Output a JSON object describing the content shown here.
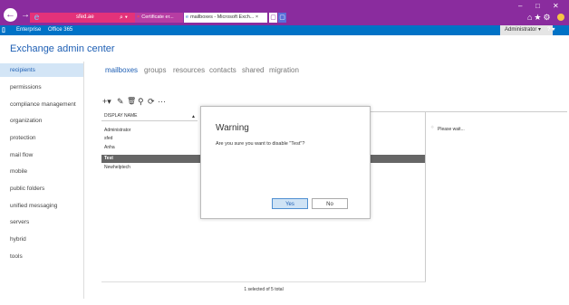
{
  "browser": {
    "address_text": "sfed.ae",
    "search_glyph": "⌕ ▾",
    "tab1_label": "Certificate er...",
    "tab2_label": "mailboxes - Microsoft Exch...",
    "tab_close": "×",
    "tab1_icon": "×",
    "tab2_icon": "e",
    "new_tab": "▢",
    "back_glyph": "←",
    "forward_glyph": "→",
    "minimize": "–",
    "maximize": "□",
    "close": "✕",
    "tools": "⌂★⚙"
  },
  "o365": {
    "enterprise": "Enterprise",
    "office365": "Office 365",
    "admin": "Administrator ▾",
    "help": "? ▾"
  },
  "eac": {
    "title": "Exchange admin center",
    "nav": [
      "recipients",
      "permissions",
      "compliance management",
      "organization",
      "protection",
      "mail flow",
      "mobile",
      "public folders",
      "unified messaging",
      "servers",
      "hybrid",
      "tools"
    ],
    "tabs": [
      "mailboxes",
      "groups",
      "resources",
      "contacts",
      "shared",
      "migration"
    ]
  },
  "toolbar": {
    "add": "+▾",
    "edit": "✎",
    "delete": "🗑",
    "search": "⚲",
    "refresh": "⟳",
    "more": "···"
  },
  "grid": {
    "header": "DISPLAY NAME",
    "sort": "▲",
    "rows": [
      "Administrator",
      "sfed",
      "Anha",
      "Test",
      "Newhelptech"
    ],
    "selected_index": 3,
    "status": "1 selected of 5 total"
  },
  "details": {
    "spinner": "⁘",
    "text": "Please wait..."
  },
  "dialog": {
    "title": "Warning",
    "message": "Are you sure you want to disable \"Test\"?",
    "yes": "Yes",
    "no": "No"
  },
  "colors": {
    "chrome": "#8a2c9e",
    "address": "#e3327a",
    "o365_bar": "#0072c6",
    "accent": "#1e5fb4",
    "selected_row": "#666666"
  }
}
